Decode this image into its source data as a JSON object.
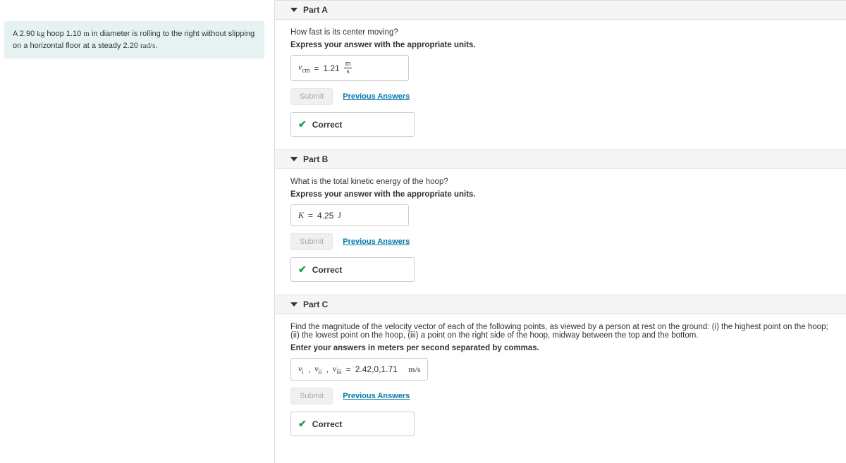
{
  "problem": {
    "text_prefix": "A 2.90 ",
    "unit1": "kg",
    "text_mid1": " hoop 1.10 ",
    "unit2": "m",
    "text_mid2": " in diameter is rolling to the right without slipping on a horizontal floor at a steady 2.20 ",
    "unit3": "rad/s",
    "text_suffix": "."
  },
  "common": {
    "submit": "Submit",
    "previous": "Previous Answers",
    "correct": "Correct"
  },
  "partA": {
    "title": "Part A",
    "question": "How fast is its center moving?",
    "instruction": "Express your answer with the appropriate units.",
    "var_label": "v",
    "var_sub": "cm",
    "eq": "=",
    "value": "1.21",
    "unit_num": "m",
    "unit_den": "s"
  },
  "partB": {
    "title": "Part B",
    "question": "What is the total kinetic energy of the hoop?",
    "instruction": "Express your answer with the appropriate units.",
    "var_label": "K",
    "eq": "=",
    "value": "4.25",
    "unit": "J"
  },
  "partC": {
    "title": "Part C",
    "question": "Find the magnitude of the velocity vector of each of the following points, as viewed by a person at rest on the ground: (i) the highest point on the hoop; (ii) the lowest point on the hoop, (iii) a point on the right side of the hoop, midway between the top and the bottom.",
    "instruction": "Enter your answers in meters per second separated by commas.",
    "var1": "v",
    "sub1": "i",
    "var2": "v",
    "sub2": "ii",
    "var3": "v",
    "sub3": "iii",
    "eq": "=",
    "value": "2.42,0,1.71",
    "unit": "m/s"
  }
}
